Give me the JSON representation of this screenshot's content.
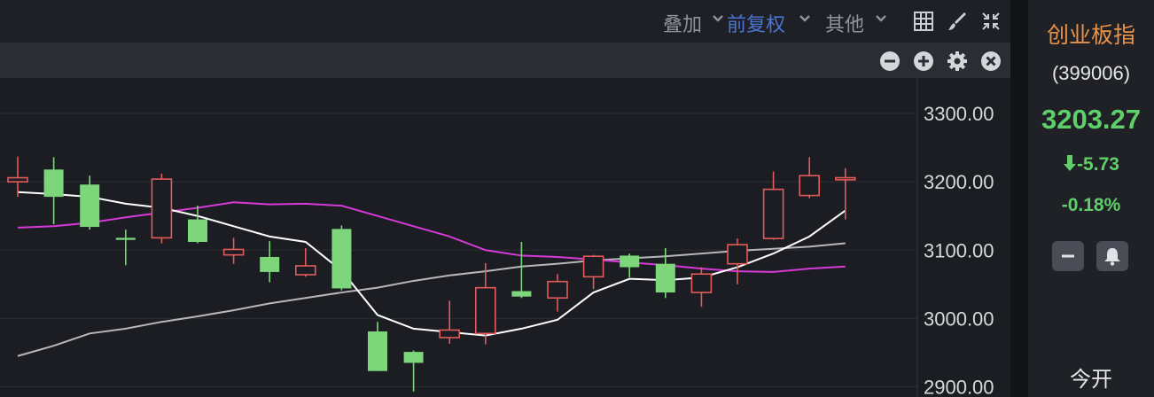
{
  "toolbar": {
    "overlay_label": "叠加",
    "adjust_label": "前复权",
    "other_label": "其他"
  },
  "side_panel": {
    "name": "创业板指",
    "code": "(399006)",
    "price": "3203.27",
    "change": "-5.73",
    "change_pct": "-0.18%",
    "open_label": "今开"
  },
  "colors": {
    "up": "#e35b5b",
    "down": "#7ed67a",
    "ma_white": "#ffffff",
    "ma_magenta": "#d63ad6",
    "ma_gray": "#b8b8b8",
    "accent_blue": "#4a74d6",
    "name_orange": "#e8924a"
  },
  "chart_data": {
    "type": "candlestick",
    "y_tick_labels": [
      "3300.00",
      "3200.00",
      "3100.00",
      "3000.00",
      "2900.00"
    ],
    "y_ticks": [
      3300,
      3200,
      3100,
      3000,
      2900
    ],
    "ylim": [
      2885,
      3352
    ],
    "candles": [
      {
        "o": 3200,
        "h": 3237,
        "l": 3178,
        "c": 3206
      },
      {
        "o": 3218,
        "h": 3236,
        "l": 3138,
        "c": 3178
      },
      {
        "o": 3196,
        "h": 3209,
        "l": 3130,
        "c": 3134
      },
      {
        "o": 3118,
        "h": 3130,
        "l": 3078,
        "c": 3115
      },
      {
        "o": 3118,
        "h": 3212,
        "l": 3110,
        "c": 3204
      },
      {
        "o": 3145,
        "h": 3165,
        "l": 3110,
        "c": 3112
      },
      {
        "o": 3093,
        "h": 3118,
        "l": 3080,
        "c": 3101
      },
      {
        "o": 3090,
        "h": 3113,
        "l": 3053,
        "c": 3068
      },
      {
        "o": 3064,
        "h": 3103,
        "l": 3061,
        "c": 3077
      },
      {
        "o": 3131,
        "h": 3136,
        "l": 3041,
        "c": 3044
      },
      {
        "o": 2981,
        "h": 2995,
        "l": 2923,
        "c": 2923
      },
      {
        "o": 2951,
        "h": 2953,
        "l": 2893,
        "c": 2935
      },
      {
        "o": 2972,
        "h": 3026,
        "l": 2963,
        "c": 2983
      },
      {
        "o": 2978,
        "h": 3081,
        "l": 2962,
        "c": 3045
      },
      {
        "o": 3040,
        "h": 3112,
        "l": 3030,
        "c": 3032
      },
      {
        "o": 3030,
        "h": 3065,
        "l": 3010,
        "c": 3054
      },
      {
        "o": 3061,
        "h": 3093,
        "l": 3043,
        "c": 3091
      },
      {
        "o": 3092,
        "h": 3095,
        "l": 3060,
        "c": 3075
      },
      {
        "o": 3080,
        "h": 3103,
        "l": 3030,
        "c": 3038
      },
      {
        "o": 3038,
        "h": 3075,
        "l": 3017,
        "c": 3065
      },
      {
        "o": 3080,
        "h": 3117,
        "l": 3050,
        "c": 3108
      },
      {
        "o": 3117,
        "h": 3215,
        "l": 3115,
        "c": 3189
      },
      {
        "o": 3180,
        "h": 3236,
        "l": 3176,
        "c": 3209
      },
      {
        "o": 3203,
        "h": 3220,
        "l": 3145,
        "c": 3206
      }
    ],
    "ma_white": [
      3185,
      3182,
      3178,
      3168,
      3162,
      3150,
      3135,
      3120,
      3112,
      3070,
      3005,
      2985,
      2980,
      2975,
      2985,
      2998,
      3038,
      3058,
      3056,
      3060,
      3075,
      3095,
      3120,
      3158
    ],
    "ma_magenta": [
      3133,
      3135,
      3140,
      3148,
      3155,
      3162,
      3170,
      3167,
      3168,
      3165,
      3150,
      3135,
      3120,
      3100,
      3092,
      3090,
      3086,
      3082,
      3078,
      3073,
      3069,
      3068,
      3073,
      3076
    ],
    "ma_gray": [
      2945,
      2960,
      2978,
      2985,
      2995,
      3003,
      3012,
      3022,
      3030,
      3038,
      3045,
      3055,
      3063,
      3069,
      3076,
      3080,
      3085,
      3088,
      3091,
      3095,
      3099,
      3102,
      3105,
      3110
    ]
  }
}
